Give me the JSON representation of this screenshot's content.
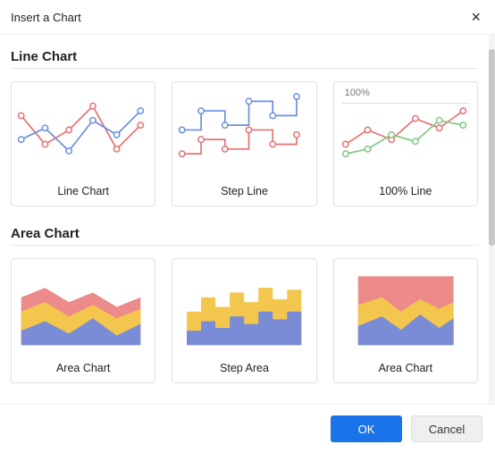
{
  "dialog": {
    "title": "Insert a Chart",
    "close_glyph": "×"
  },
  "sections": [
    {
      "title": "Line Chart",
      "cards": [
        {
          "label": "Line Chart",
          "kind": "line-chart"
        },
        {
          "label": "Step Line",
          "kind": "step-line"
        },
        {
          "label": "100% Line",
          "kind": "line-100",
          "badge": "100%"
        }
      ]
    },
    {
      "title": "Area Chart",
      "cards": [
        {
          "label": "Area Chart",
          "kind": "area-chart"
        },
        {
          "label": "Step Area",
          "kind": "step-area"
        },
        {
          "label": "Area Chart",
          "kind": "stacked-area"
        }
      ]
    }
  ],
  "buttons": {
    "ok": "OK",
    "cancel": "Cancel"
  },
  "colors": {
    "red": "#e57373",
    "blue": "#6b8fe0",
    "green": "#81c784",
    "yellow": "#f3c64d",
    "blueFill": "#7a8cd6",
    "redFill": "#ed8a8a",
    "yellowFill": "#f3c64d"
  }
}
